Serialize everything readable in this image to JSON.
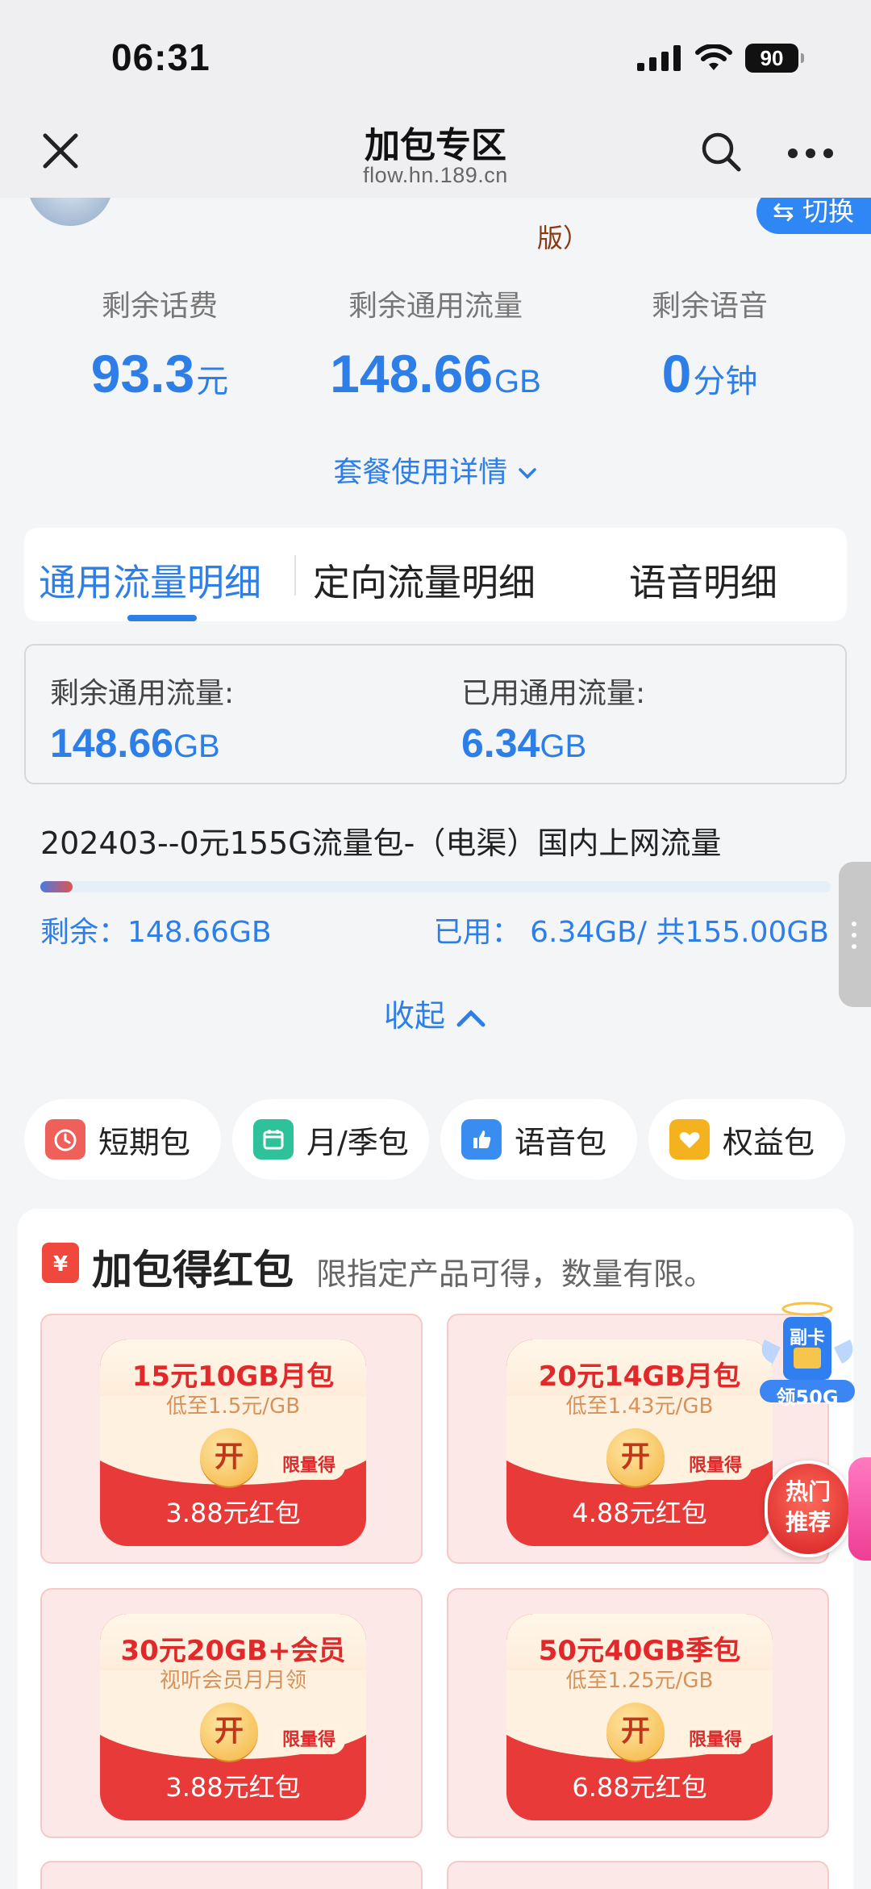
{
  "status": {
    "time": "06:31",
    "battery": "90"
  },
  "nav": {
    "title": "加包专区",
    "subtitle": "flow.hn.189.cn"
  },
  "account": {
    "edition_fragment": "版）",
    "switch_label": "切换"
  },
  "balances": [
    {
      "label": "剩余话费",
      "value": "93.3",
      "unit": "元"
    },
    {
      "label": "剩余通用流量",
      "value": "148.66",
      "unit": "GB"
    },
    {
      "label": "剩余语音",
      "value": "0",
      "unit": "分钟"
    }
  ],
  "detail_link": "套餐使用详情",
  "tabs": [
    {
      "label": "通用流量明细",
      "active": true
    },
    {
      "label": "定向流量明细",
      "active": false
    },
    {
      "label": "语音明细",
      "active": false
    }
  ],
  "flow_summary": {
    "remaining_label": "剩余通用流量:",
    "remaining_value": "148.66",
    "remaining_unit": "GB",
    "used_label": "已用通用流量:",
    "used_value": "6.34",
    "used_unit": "GB"
  },
  "package": {
    "name": "202403--0元155G流量包-（电渠）国内上网流量",
    "remaining_text": "剩余：148.66GB",
    "used_text": "已用： 6.34GB/ 共155.00GB",
    "used_fraction": 0.041
  },
  "collapse_label": "收起",
  "categories": [
    {
      "label": "短期包",
      "icon": "clock-icon",
      "color": "#f0605a"
    },
    {
      "label": "月/季包",
      "icon": "calendar-icon",
      "color": "#2ec29a"
    },
    {
      "label": "语音包",
      "icon": "thumbs-up-icon",
      "color": "#3a8df0"
    },
    {
      "label": "权益包",
      "icon": "heart-icon",
      "color": "#f5b21f"
    }
  ],
  "redpacket": {
    "icon_char": "¥",
    "title": "加包得红包",
    "subtitle": "限指定产品可得，数量有限。",
    "open_char": "开",
    "badge": "限量得",
    "items": [
      {
        "title": "15元10GB月包",
        "sub": "低至1.5元/GB",
        "amount": "3.88元红包"
      },
      {
        "title": "20元14GB月包",
        "sub": "低至1.43元/GB",
        "amount": "4.88元红包"
      },
      {
        "title": "30元20GB+会员",
        "sub": "视听会员月月领",
        "amount": "3.88元红包"
      },
      {
        "title": "50元40GB季包",
        "sub": "低至1.25元/GB",
        "amount": "6.88元红包"
      }
    ]
  },
  "floaters": {
    "sim_top": "副卡",
    "sim_label": "领50G",
    "hot_line1": "热门",
    "hot_line2": "推荐"
  }
}
